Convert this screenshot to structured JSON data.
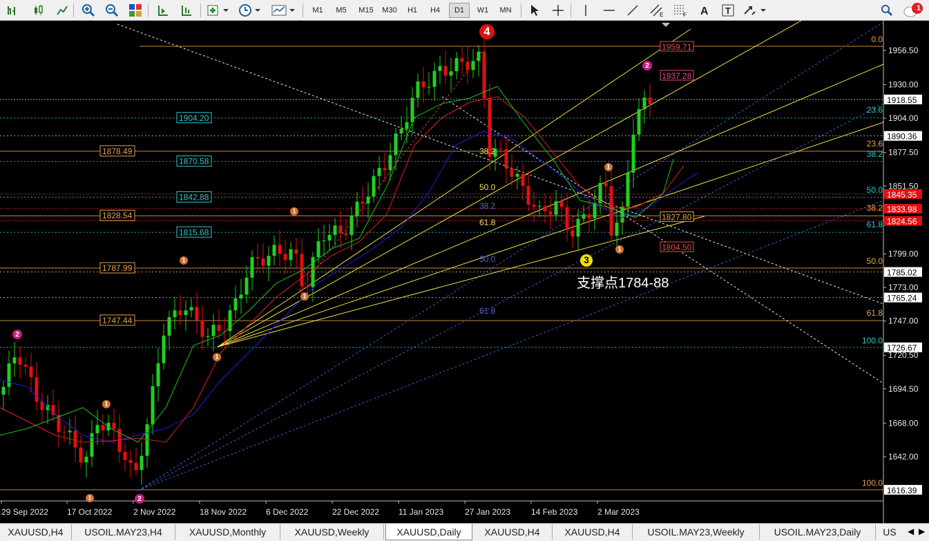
{
  "toolbar": {
    "periods": [
      "M1",
      "M5",
      "M15",
      "M30",
      "H1",
      "H4",
      "D1",
      "W1",
      "MN"
    ],
    "active_period": "D1",
    "notification_count": "1"
  },
  "chart_data": {
    "type": "candlestick",
    "symbol": "XAUUSD",
    "timeframe": "Daily",
    "ylim": [
      1600,
      1980
    ],
    "price_ticks": [
      "1956.50",
      "1930.00",
      "1904.00",
      "1877.50",
      "1851.50",
      "1825.00",
      "1799.00",
      "1773.00",
      "1747.00",
      "1720.50",
      "1694.50",
      "1668.00",
      "1642.00"
    ],
    "date_labels": [
      "29 Sep 2022",
      "17 Oct 2022",
      "2 Nov 2022",
      "18 Nov 2022",
      "6 Dec 2022",
      "22 Dec 2022",
      "11 Jan 2023",
      "27 Jan 2023",
      "14 Feb 2023",
      "2 Mar 2023"
    ],
    "price_tags": [
      {
        "value": "1918.55",
        "bg": "#ffffff",
        "fg": "#000000"
      },
      {
        "value": "1890.36",
        "bg": "#ffffff",
        "fg": "#000000"
      },
      {
        "value": "1845.35",
        "bg": "#e01010",
        "fg": "#ffffff"
      },
      {
        "value": "1833.98",
        "bg": "#e01010",
        "fg": "#ffffff"
      },
      {
        "value": "1824.56",
        "bg": "#e01010",
        "fg": "#ffffff"
      },
      {
        "value": "1785.02",
        "bg": "#ffffff",
        "fg": "#000000"
      },
      {
        "value": "1765.24",
        "bg": "#ffffff",
        "fg": "#000000"
      },
      {
        "value": "1726.67",
        "bg": "#ffffff",
        "fg": "#000000"
      },
      {
        "value": "1616.39",
        "bg": "#ffffff",
        "fg": "#000000"
      }
    ],
    "left_levels": [
      {
        "value": "1904.20",
        "color": "#30c8c8"
      },
      {
        "value": "1878.49",
        "color": "#e8a050"
      },
      {
        "value": "1870.58",
        "color": "#30c8c8"
      },
      {
        "value": "1842.88",
        "color": "#30c8c8"
      },
      {
        "value": "1828.54",
        "color": "#e8a050"
      },
      {
        "value": "1815.68",
        "color": "#30c8c8"
      },
      {
        "value": "1787.99",
        "color": "#e8a050"
      },
      {
        "value": "1747.44",
        "color": "#e8a050"
      }
    ],
    "right_markers": [
      {
        "value": "1959.71",
        "color": "#e05050"
      },
      {
        "value": "1937.28",
        "color": "#e05080"
      },
      {
        "value": "1827.80",
        "color": "#e8a050"
      },
      {
        "value": "1804.50",
        "color": "#e05050"
      }
    ],
    "fib_right": [
      {
        "label": "0.0",
        "color": "#e8a050"
      },
      {
        "label": "23.6",
        "color": "#30c8c8"
      },
      {
        "label": "23.6",
        "color": "#e8a050"
      },
      {
        "label": "38.2",
        "color": "#30c8c8"
      },
      {
        "label": "50.0",
        "color": "#30c8c8"
      },
      {
        "label": "38.2",
        "color": "#e8a050"
      },
      {
        "label": "61.8",
        "color": "#30c8c8"
      },
      {
        "label": "50.0",
        "color": "#e8a050"
      },
      {
        "label": "61.8",
        "color": "#e8a050"
      },
      {
        "label": "100.0",
        "color": "#30c8c8"
      },
      {
        "label": "100.0",
        "color": "#e8a050"
      }
    ],
    "fib_mid": [
      {
        "label": "38.2",
        "color": "#e8e060"
      },
      {
        "label": "50.0",
        "color": "#e8e060"
      },
      {
        "label": "61.8",
        "color": "#e8e060"
      },
      {
        "label": "38.2",
        "color": "#6060c0"
      },
      {
        "label": "50.0",
        "color": "#6060c0"
      },
      {
        "label": "61.8",
        "color": "#6060c0"
      }
    ],
    "wave_labels": [
      "4",
      "3",
      "2",
      "2",
      "1",
      "1",
      "1",
      "1",
      "1",
      "1",
      "1",
      "2",
      "1"
    ],
    "annotation": "支撑点1784-88"
  },
  "tabs": [
    "XAUUSD,H4",
    "USOIL.MAY23,H4",
    "XAUUSD,Monthly",
    "XAUUSD,Weekly",
    "XAUUSD,Daily",
    "XAUUSD,H4",
    "XAUUSD,H4",
    "USOIL.MAY23,Weekly",
    "USOIL.MAY23,Daily",
    "US"
  ],
  "active_tab": "XAUUSD,Daily"
}
